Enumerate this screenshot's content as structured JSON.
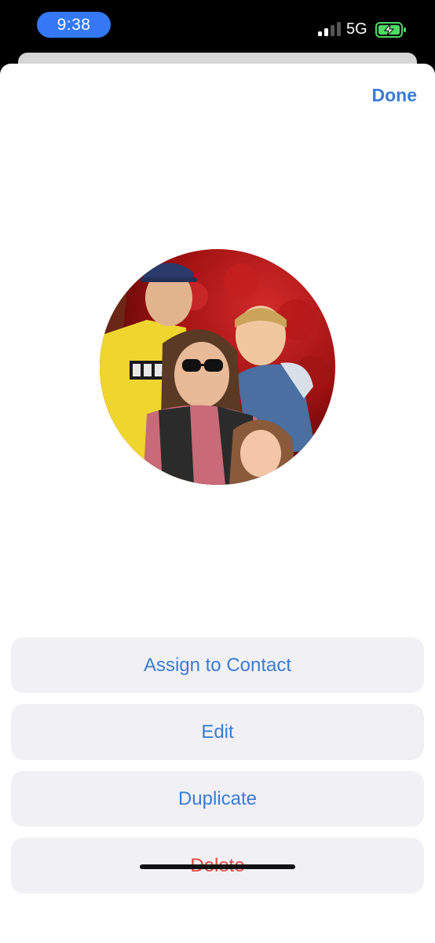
{
  "status_bar": {
    "time": "9:38",
    "network": "5G",
    "time_pill_color": "#3478f6",
    "battery_icon": "battery-charging-icon"
  },
  "header": {
    "done_label": "Done"
  },
  "photo": {
    "icon": "contact-photo-avatar"
  },
  "actions": [
    {
      "label": "Assign to Contact",
      "color": "#3a7bd5"
    },
    {
      "label": "Edit",
      "color": "#3a7bd5"
    },
    {
      "label": "Duplicate",
      "color": "#3a7bd5"
    },
    {
      "label": "Delete",
      "color": "#e0443e"
    }
  ]
}
